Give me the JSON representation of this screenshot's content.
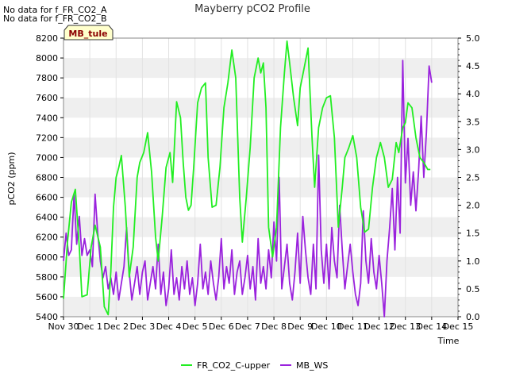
{
  "notices": [
    "No data for f_FR_CO2_A",
    "No data for f_FR_CO2_B"
  ],
  "badge": "MB_tule",
  "colors": {
    "co2": "#22ee22",
    "ws": "#9a22dd",
    "band": "#efefef",
    "badge_bg": "#ffffcc",
    "badge_text": "#8b0000"
  },
  "chart_data": {
    "type": "line",
    "title": "Mayberry pCO2 Profile",
    "xlabel": "Time",
    "ylabel": "pCO2 (ppm)",
    "ylim": [
      5400,
      8200
    ],
    "y2lim": [
      0.0,
      5.0
    ],
    "xlim": [
      0,
      15
    ],
    "x_ticks": [
      "Nov 30",
      "Dec 1",
      "Dec 2",
      "Dec 3",
      "Dec 4",
      "Dec 5",
      "Dec 6",
      "Dec 7",
      "Dec 8",
      "Dec 9",
      "Dec 10",
      "Dec 11",
      "Dec 12",
      "Dec 13",
      "Dec 14",
      "Dec 15"
    ],
    "y_ticks": [
      5400,
      5600,
      5800,
      6000,
      6200,
      6400,
      6600,
      6800,
      7000,
      7200,
      7400,
      7600,
      7800,
      8000,
      8200
    ],
    "y2_ticks": [
      "0.0",
      "0.5",
      "1.0",
      "1.5",
      "2.0",
      "2.5",
      "3.0",
      "3.5",
      "4.0",
      "4.5",
      "5.0"
    ],
    "legend_position": "bottom",
    "series": [
      {
        "name": "FR_CO2_C-upper",
        "axis": "left",
        "x": [
          0.0,
          0.15,
          0.3,
          0.45,
          0.6,
          0.7,
          0.9,
          1.05,
          1.2,
          1.4,
          1.55,
          1.7,
          1.8,
          1.9,
          2.0,
          2.1,
          2.2,
          2.35,
          2.5,
          2.65,
          2.8,
          2.9,
          3.05,
          3.2,
          3.35,
          3.5,
          3.6,
          3.75,
          3.9,
          4.05,
          4.15,
          4.3,
          4.45,
          4.55,
          4.65,
          4.75,
          4.85,
          4.95,
          5.1,
          5.25,
          5.4,
          5.5,
          5.65,
          5.8,
          5.95,
          6.1,
          6.25,
          6.4,
          6.55,
          6.7,
          6.8,
          6.95,
          7.1,
          7.25,
          7.4,
          7.5,
          7.6,
          7.7,
          7.8,
          7.95,
          8.1,
          8.25,
          8.4,
          8.5,
          8.6,
          8.75,
          8.9,
          9.0,
          9.15,
          9.3,
          9.45,
          9.55,
          9.7,
          9.85,
          10.0,
          10.15,
          10.3,
          10.45,
          10.6,
          10.7,
          10.85,
          11.0,
          11.15,
          11.3,
          11.45,
          11.6,
          11.75,
          11.9,
          12.05,
          12.2,
          12.35,
          12.5,
          12.65,
          12.75,
          12.9,
          13.0,
          13.1,
          13.25,
          13.4,
          13.55,
          13.7,
          13.85,
          13.95
        ],
        "y": [
          5580,
          6150,
          6550,
          6680,
          6100,
          5600,
          5620,
          6100,
          6320,
          6100,
          5500,
          5420,
          5850,
          6500,
          6800,
          6900,
          7020,
          6500,
          5800,
          6100,
          6800,
          6950,
          7050,
          7250,
          6850,
          6200,
          5960,
          6400,
          6900,
          7050,
          6750,
          7560,
          7400,
          6950,
          6600,
          6470,
          6520,
          6900,
          7550,
          7700,
          7750,
          7000,
          6500,
          6520,
          6900,
          7500,
          7750,
          8080,
          7800,
          6600,
          6150,
          6600,
          7100,
          7800,
          8000,
          7850,
          7950,
          7500,
          6300,
          6000,
          6300,
          7300,
          7850,
          8170,
          7950,
          7600,
          7320,
          7700,
          7900,
          8100,
          7200,
          6700,
          7300,
          7500,
          7600,
          7620,
          7200,
          6300,
          6700,
          7000,
          7100,
          7220,
          7000,
          6500,
          6250,
          6280,
          6700,
          7000,
          7150,
          7000,
          6700,
          6780,
          7150,
          7050,
          7300,
          7350,
          7550,
          7500,
          7200,
          7000,
          6950,
          6880,
          6880
        ]
      },
      {
        "name": "MB_WS",
        "axis": "right",
        "x": [
          0.0,
          0.1,
          0.2,
          0.3,
          0.4,
          0.5,
          0.6,
          0.7,
          0.8,
          0.9,
          1.0,
          1.1,
          1.2,
          1.3,
          1.4,
          1.5,
          1.6,
          1.7,
          1.8,
          1.9,
          2.0,
          2.1,
          2.2,
          2.3,
          2.4,
          2.5,
          2.6,
          2.7,
          2.8,
          2.9,
          3.0,
          3.1,
          3.2,
          3.3,
          3.4,
          3.5,
          3.6,
          3.7,
          3.8,
          3.9,
          4.0,
          4.1,
          4.2,
          4.3,
          4.4,
          4.5,
          4.6,
          4.7,
          4.8,
          4.9,
          5.0,
          5.1,
          5.2,
          5.3,
          5.4,
          5.5,
          5.6,
          5.7,
          5.8,
          5.9,
          6.0,
          6.1,
          6.2,
          6.3,
          6.4,
          6.5,
          6.6,
          6.7,
          6.8,
          6.9,
          7.0,
          7.1,
          7.2,
          7.3,
          7.4,
          7.5,
          7.6,
          7.7,
          7.8,
          7.9,
          8.0,
          8.1,
          8.2,
          8.3,
          8.4,
          8.5,
          8.6,
          8.7,
          8.8,
          8.9,
          9.0,
          9.1,
          9.2,
          9.3,
          9.4,
          9.5,
          9.6,
          9.7,
          9.8,
          9.9,
          10.0,
          10.1,
          10.2,
          10.3,
          10.4,
          10.5,
          10.6,
          10.7,
          10.8,
          10.9,
          11.0,
          11.1,
          11.2,
          11.3,
          11.4,
          11.5,
          11.6,
          11.7,
          11.8,
          11.9,
          12.0,
          12.1,
          12.2,
          12.3,
          12.4,
          12.5,
          12.6,
          12.7,
          12.8,
          12.9,
          13.0,
          13.1,
          13.2,
          13.3,
          13.4,
          13.5,
          13.6,
          13.7,
          13.8,
          13.9,
          14.0
        ],
        "y": [
          1.0,
          1.5,
          1.1,
          1.2,
          2.2,
          1.3,
          1.8,
          1.1,
          1.4,
          1.1,
          1.2,
          0.9,
          2.2,
          1.5,
          1.0,
          0.7,
          0.9,
          0.5,
          0.7,
          0.4,
          0.8,
          0.3,
          0.6,
          0.9,
          1.6,
          0.8,
          0.3,
          0.6,
          0.9,
          0.4,
          0.8,
          1.0,
          0.3,
          0.6,
          0.9,
          0.5,
          1.3,
          0.4,
          0.8,
          0.2,
          0.5,
          1.2,
          0.4,
          0.7,
          0.3,
          0.9,
          0.5,
          1.0,
          0.4,
          0.7,
          0.2,
          0.6,
          1.3,
          0.5,
          0.8,
          0.4,
          1.0,
          0.6,
          0.3,
          0.7,
          1.4,
          0.5,
          0.9,
          0.6,
          1.2,
          0.4,
          0.8,
          1.0,
          0.4,
          0.7,
          1.1,
          0.5,
          0.9,
          0.3,
          1.4,
          0.6,
          0.9,
          0.5,
          1.2,
          0.7,
          1.7,
          1.0,
          2.5,
          0.5,
          0.9,
          1.3,
          0.6,
          0.3,
          0.8,
          1.5,
          0.6,
          1.8,
          1.2,
          0.7,
          0.4,
          1.3,
          0.5,
          2.9,
          1.2,
          0.6,
          1.3,
          0.5,
          1.6,
          1.0,
          0.7,
          2.0,
          1.2,
          0.5,
          0.9,
          1.3,
          0.8,
          0.4,
          0.2,
          0.6,
          1.9,
          1.0,
          0.6,
          1.4,
          0.8,
          0.5,
          1.1,
          0.6,
          0.0,
          1.0,
          1.6,
          2.3,
          1.2,
          2.5,
          1.5,
          4.6,
          2.4,
          3.2,
          2.0,
          2.6,
          1.9,
          2.6,
          3.6,
          2.5,
          3.3,
          4.5,
          4.2
        ]
      }
    ]
  }
}
